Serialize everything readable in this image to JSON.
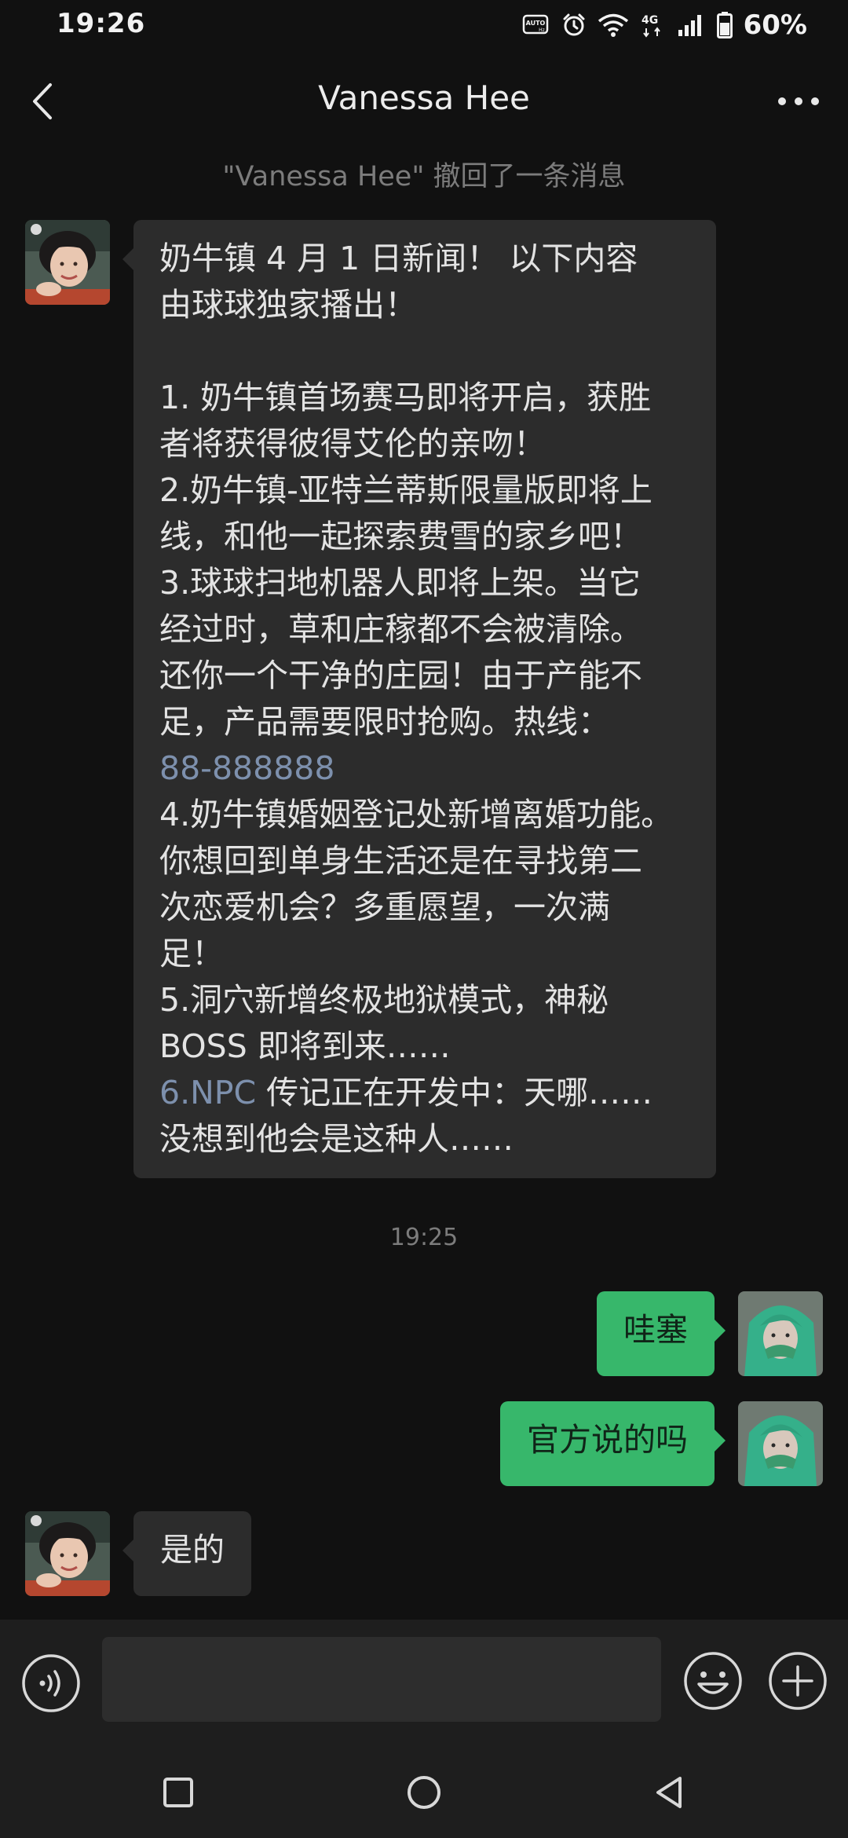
{
  "status_bar": {
    "time": "19:26",
    "battery_percent": "60%",
    "network": "4G",
    "icons": [
      "auto-brightness-icon",
      "alarm-icon",
      "wifi-icon",
      "4g-icon",
      "cellular-signal-icon",
      "battery-icon"
    ]
  },
  "header": {
    "title": "Vanessa Hee",
    "back_icon": "back-chevron-icon",
    "more_icon": "more-dots-icon"
  },
  "chat": {
    "recall_notice": "\"Vanessa Hee\" 撤回了一条消息",
    "news_message": {
      "lines": [
        "奶牛镇 4 月 1 日新闻！ 以下内容",
        "由球球独家播出！",
        "",
        "1. 奶牛镇首场赛马即将开启，获胜",
        "者将获得彼得艾伦的亲吻！",
        "2.奶牛镇-亚特兰蒂斯限量版即将上",
        "线，和他一起探索费雪的家乡吧！",
        "3.球球扫地机器人即将上架。当它",
        "经过时，草和庄稼都不会被清除。",
        "还你一个干净的庄园！由于产能不",
        "足，产品需要限时抢购。热线："
      ],
      "hotline": "88-888888",
      "lines_after": [
        "4.奶牛镇婚姻登记处新增离婚功能。",
        "你想回到单身生活还是在寻找第二",
        "次恋爱机会？多重愿望，一次满",
        "足！",
        "5.洞穴新增终极地狱模式，神秘",
        "BOSS 即将到来……"
      ],
      "npc_link": "6.NPC",
      "npc_rest": " 传记正在开发中：天哪……",
      "last_line": "没想到他会是这种人……"
    },
    "timestamp": "19:25",
    "sent_messages": [
      "哇塞",
      "官方说的吗"
    ],
    "reply_message": "是的"
  },
  "input_bar": {
    "input_value": "",
    "voice_icon": "voice-input-icon",
    "emoji_icon": "emoji-icon",
    "plus_icon": "plus-circle-icon"
  },
  "nav_bar": {
    "icons": [
      "recent-apps-square-icon",
      "home-circle-icon",
      "back-triangle-icon"
    ]
  },
  "colors": {
    "background": "#111111",
    "incoming_bubble": "#2c2c2c",
    "outgoing_bubble": "#37b76b",
    "link": "#7d90ad",
    "input_bar": "#1e1e1e"
  }
}
